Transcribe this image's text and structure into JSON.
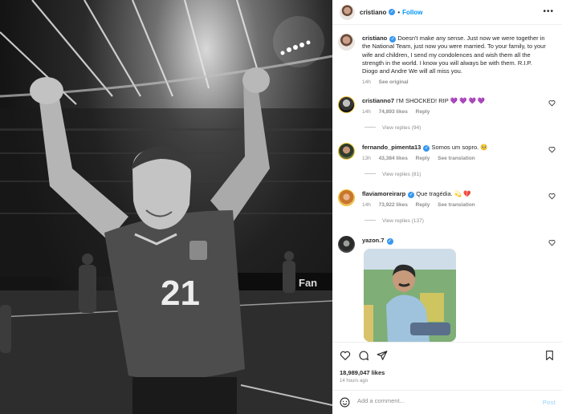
{
  "photo": {
    "jersey_number": "21",
    "ad_board_text": "Fan"
  },
  "header": {
    "username": "cristiano",
    "separator": "•",
    "follow_label": "Follow",
    "more_label": "•••"
  },
  "caption": {
    "username": "cristiano",
    "text": "Doesn't make any sense. Just now we were together in the National Team, just now you were married. To your family, to your wife and children, I send my condolences and wish them all the strength in the world. I know you will always be with them. R.I.P. Diogo and Andre We will all miss you.",
    "time": "14h",
    "see_original": "See original"
  },
  "comments": [
    {
      "username": "cristianno7",
      "verified": false,
      "text": "I'M SHOCKED! RIP 💜 💜 💜 💜",
      "time": "14h",
      "likes": "74,893 likes",
      "reply": "Reply",
      "see_translation": "",
      "view_replies": "View replies (94)"
    },
    {
      "username": "fernando_pimenta13",
      "verified": true,
      "text": "Somos um sopro. 🥺",
      "time": "13h",
      "likes": "43,384 likes",
      "reply": "Reply",
      "see_translation": "See translation",
      "view_replies": "View replies (81)"
    },
    {
      "username": "flaviamoreirarp",
      "verified": true,
      "text": "Que tragédia. 💫 💔",
      "time": "14h",
      "likes": "73,922 likes",
      "reply": "Reply",
      "see_translation": "See translation",
      "view_replies": "View replies (137)"
    },
    {
      "username": "yazon.7",
      "verified": true,
      "text": "",
      "time": "",
      "likes": "",
      "reply": "",
      "see_translation": "",
      "view_replies": ""
    }
  ],
  "footer": {
    "likes": "18,989,047 likes",
    "time_ago": "14 hours ago",
    "comment_placeholder": "Add a comment...",
    "post_label": "Post"
  },
  "icons": {
    "verified": "verified-badge-icon",
    "heart": "heart-icon",
    "comment": "comment-icon",
    "share": "share-icon",
    "save": "bookmark-icon",
    "emoji": "emoji-icon"
  },
  "colors": {
    "accent": "#0095f6",
    "verified": "#3897f0",
    "muted": "#8e8e8e",
    "text": "#262626"
  }
}
